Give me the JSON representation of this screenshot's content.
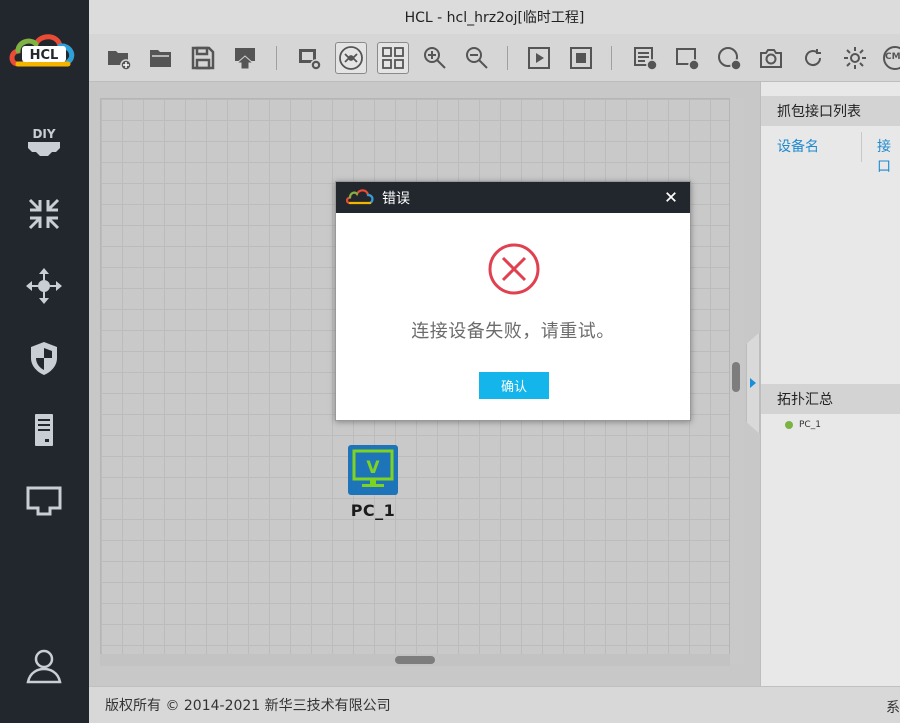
{
  "window": {
    "title": "HCL - hcl_hrz2oj[临时工程]"
  },
  "logo": {
    "text": "HCL"
  },
  "sidebar": {
    "items": [
      {
        "name": "diy",
        "icon": "diy-icon"
      },
      {
        "name": "router",
        "icon": "router-icon"
      },
      {
        "name": "switch",
        "icon": "switch-icon"
      },
      {
        "name": "security",
        "icon": "shield-icon"
      },
      {
        "name": "server",
        "icon": "server-icon"
      },
      {
        "name": "terminal",
        "icon": "terminal-icon"
      },
      {
        "name": "user",
        "icon": "user-icon"
      }
    ]
  },
  "toolbar": {
    "items": [
      "new-project-icon",
      "open-folder-icon",
      "save-icon",
      "export-icon",
      "capture-view-icon",
      "topology-view-icon",
      "grid-view-icon",
      "zoom-in-icon",
      "zoom-out-icon",
      "start-icon",
      "stop-icon",
      "add-list-icon",
      "add-box-icon",
      "add-circle-icon",
      "camera-icon",
      "refresh-icon",
      "settings-icon",
      "cmd-icon"
    ],
    "cmd_label": "CMD"
  },
  "canvas": {
    "devices": [
      {
        "label": "PC_1",
        "icon": "pc-icon",
        "badge": "V"
      }
    ]
  },
  "right_panel": {
    "capture_header": "抓包接口列表",
    "col_device": "设备名",
    "col_interface": "接口",
    "topo_header": "拓扑汇总",
    "topo_items": [
      "PC_1"
    ]
  },
  "statusbar": {
    "copyright": "版权所有 © 2014-2021 新华三技术有限公司",
    "right_text": "系"
  },
  "dialog": {
    "title": "错误",
    "message": "连接设备失败，请重试。",
    "ok_label": "确认"
  },
  "colors": {
    "sidebar_bg": "#22272d",
    "accent": "#13b5ea",
    "error_red": "#e0404f",
    "link_blue": "#1e8ad0"
  }
}
